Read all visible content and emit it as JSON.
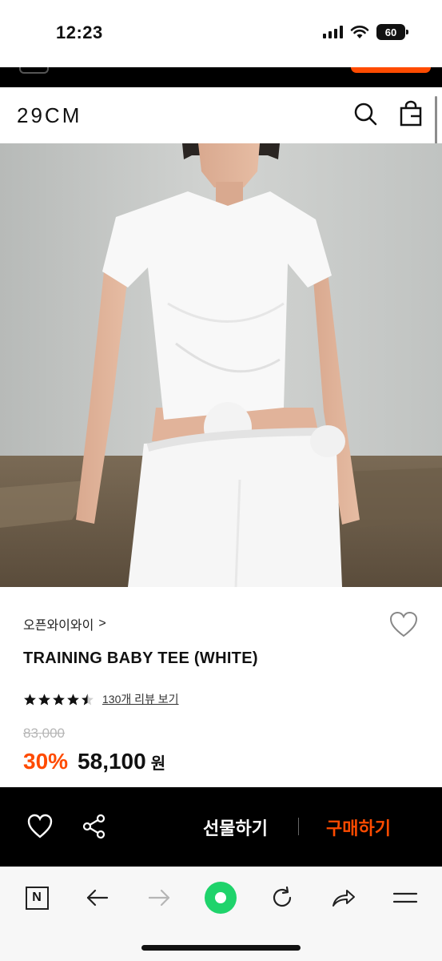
{
  "status": {
    "time": "12:23",
    "battery": "60"
  },
  "header": {
    "logo": "29CM",
    "search_icon": "search-icon",
    "cart_icon": "shopping-bag-icon"
  },
  "product": {
    "brand": "오픈와이와이",
    "brand_chevron": ">",
    "title": "TRAINING BABY TEE (WHITE)",
    "rating": 4.5,
    "rating_max": 5,
    "review_link": "130개 리뷰 보기",
    "original_price": "83,000",
    "discount": "30%",
    "sale_price": "58,100",
    "currency": "원"
  },
  "purchase_bar": {
    "gift_label": "선물하기",
    "buy_label": "구매하기",
    "heart_icon": "heart-icon",
    "share_icon": "share-icon"
  },
  "browser": {
    "n_label": "N"
  },
  "colors": {
    "accent": "#ff4b00",
    "bar": "#000000",
    "green": "#1fd36b"
  }
}
